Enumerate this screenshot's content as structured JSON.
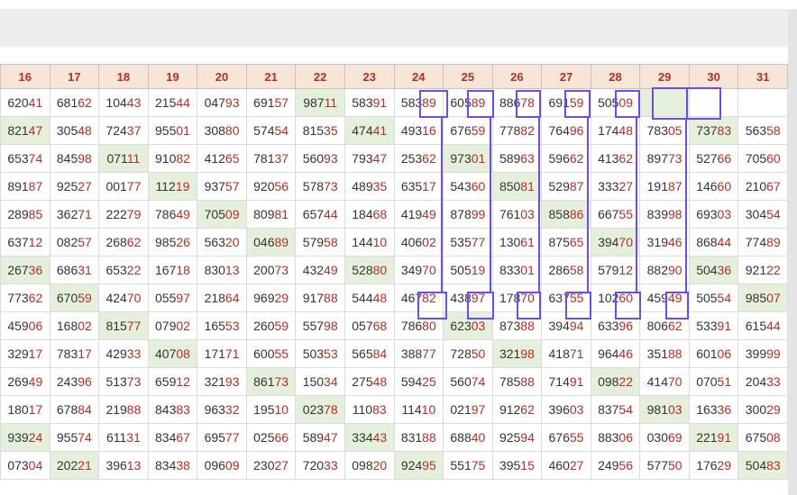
{
  "columns": [
    "16",
    "17",
    "18",
    "19",
    "20",
    "21",
    "22",
    "23",
    "24",
    "25",
    "26",
    "27",
    "28",
    "29",
    "30",
    "31"
  ],
  "rows": [
    [
      [
        "620",
        "41",
        0
      ],
      [
        "681",
        "62",
        0
      ],
      [
        "104",
        "43",
        0
      ],
      [
        "215",
        "44",
        0
      ],
      [
        "047",
        "93",
        0
      ],
      [
        "691",
        "57",
        0
      ],
      [
        "987",
        "11",
        1
      ],
      [
        "583",
        "91",
        0
      ],
      [
        "583",
        "89",
        0
      ],
      [
        "605",
        "89",
        0
      ],
      [
        "886",
        "78",
        0
      ],
      [
        "691",
        "59",
        0
      ],
      [
        "505",
        "09",
        0
      ],
      [
        "",
        "",
        1
      ],
      [
        "",
        "",
        0
      ],
      [
        "",
        "",
        0
      ]
    ],
    [
      [
        "821",
        "47",
        1
      ],
      [
        "305",
        "48",
        0
      ],
      [
        "724",
        "37",
        0
      ],
      [
        "955",
        "01",
        0
      ],
      [
        "308",
        "80",
        0
      ],
      [
        "574",
        "54",
        0
      ],
      [
        "815",
        "35",
        0
      ],
      [
        "474",
        "41",
        1
      ],
      [
        "493",
        "16",
        0
      ],
      [
        "676",
        "59",
        0
      ],
      [
        "778",
        "82",
        0
      ],
      [
        "764",
        "96",
        0
      ],
      [
        "174",
        "48",
        0
      ],
      [
        "783",
        "05",
        0
      ],
      [
        "737",
        "83",
        1
      ],
      [
        "563",
        "58",
        0
      ]
    ],
    [
      [
        "653",
        "74",
        0
      ],
      [
        "845",
        "98",
        0
      ],
      [
        "071",
        "11",
        1
      ],
      [
        "910",
        "82",
        0
      ],
      [
        "412",
        "65",
        0
      ],
      [
        "781",
        "37",
        0
      ],
      [
        "560",
        "93",
        0
      ],
      [
        "793",
        "47",
        0
      ],
      [
        "253",
        "62",
        0
      ],
      [
        "973",
        "01",
        1
      ],
      [
        "589",
        "63",
        0
      ],
      [
        "596",
        "62",
        0
      ],
      [
        "413",
        "62",
        0
      ],
      [
        "897",
        "73",
        0
      ],
      [
        "527",
        "66",
        0
      ],
      [
        "705",
        "60",
        0
      ]
    ],
    [
      [
        "891",
        "87",
        0
      ],
      [
        "925",
        "27",
        0
      ],
      [
        "001",
        "77",
        0
      ],
      [
        "112",
        "19",
        1
      ],
      [
        "937",
        "57",
        0
      ],
      [
        "920",
        "56",
        0
      ],
      [
        "578",
        "73",
        0
      ],
      [
        "489",
        "35",
        0
      ],
      [
        "635",
        "17",
        0
      ],
      [
        "543",
        "60",
        0
      ],
      [
        "850",
        "81",
        1
      ],
      [
        "529",
        "87",
        0
      ],
      [
        "333",
        "27",
        0
      ],
      [
        "191",
        "87",
        0
      ],
      [
        "146",
        "60",
        0
      ],
      [
        "210",
        "67",
        0
      ]
    ],
    [
      [
        "289",
        "85",
        0
      ],
      [
        "362",
        "71",
        0
      ],
      [
        "222",
        "79",
        0
      ],
      [
        "786",
        "49",
        0
      ],
      [
        "705",
        "09",
        1
      ],
      [
        "809",
        "81",
        0
      ],
      [
        "657",
        "44",
        0
      ],
      [
        "184",
        "68",
        0
      ],
      [
        "419",
        "49",
        0
      ],
      [
        "878",
        "99",
        0
      ],
      [
        "761",
        "03",
        0
      ],
      [
        "858",
        "86",
        1
      ],
      [
        "667",
        "55",
        0
      ],
      [
        "839",
        "98",
        0
      ],
      [
        "693",
        "03",
        0
      ],
      [
        "304",
        "54",
        0
      ]
    ],
    [
      [
        "637",
        "12",
        0
      ],
      [
        "082",
        "57",
        0
      ],
      [
        "268",
        "62",
        0
      ],
      [
        "985",
        "26",
        0
      ],
      [
        "563",
        "20",
        0
      ],
      [
        "046",
        "89",
        1
      ],
      [
        "579",
        "58",
        0
      ],
      [
        "144",
        "10",
        0
      ],
      [
        "406",
        "02",
        0
      ],
      [
        "535",
        "77",
        0
      ],
      [
        "130",
        "61",
        0
      ],
      [
        "875",
        "65",
        0
      ],
      [
        "394",
        "70",
        1
      ],
      [
        "319",
        "46",
        0
      ],
      [
        "868",
        "44",
        0
      ],
      [
        "774",
        "89",
        0
      ]
    ],
    [
      [
        "267",
        "36",
        1
      ],
      [
        "686",
        "31",
        0
      ],
      [
        "653",
        "22",
        0
      ],
      [
        "167",
        "18",
        0
      ],
      [
        "830",
        "13",
        0
      ],
      [
        "200",
        "73",
        0
      ],
      [
        "432",
        "49",
        0
      ],
      [
        "528",
        "80",
        1
      ],
      [
        "349",
        "70",
        0
      ],
      [
        "505",
        "19",
        0
      ],
      [
        "833",
        "01",
        0
      ],
      [
        "286",
        "58",
        0
      ],
      [
        "579",
        "12",
        0
      ],
      [
        "882",
        "90",
        0
      ],
      [
        "504",
        "36",
        1
      ],
      [
        "921",
        "22",
        0
      ]
    ],
    [
      [
        "773",
        "62",
        0
      ],
      [
        "670",
        "59",
        1
      ],
      [
        "424",
        "70",
        0
      ],
      [
        "055",
        "97",
        0
      ],
      [
        "218",
        "64",
        0
      ],
      [
        "969",
        "29",
        0
      ],
      [
        "917",
        "88",
        0
      ],
      [
        "544",
        "48",
        0
      ],
      [
        "467",
        "82",
        0
      ],
      [
        "438",
        "97",
        0
      ],
      [
        "178",
        "70",
        0
      ],
      [
        "637",
        "55",
        0
      ],
      [
        "102",
        "60",
        0
      ],
      [
        "459",
        "49",
        0
      ],
      [
        "505",
        "54",
        0
      ],
      [
        "985",
        "07",
        1
      ]
    ],
    [
      [
        "459",
        "06",
        0
      ],
      [
        "168",
        "02",
        0
      ],
      [
        "815",
        "77",
        1
      ],
      [
        "079",
        "02",
        0
      ],
      [
        "165",
        "53",
        0
      ],
      [
        "260",
        "59",
        0
      ],
      [
        "557",
        "98",
        0
      ],
      [
        "057",
        "68",
        0
      ],
      [
        "786",
        "80",
        0
      ],
      [
        "623",
        "03",
        1
      ],
      [
        "873",
        "88",
        0
      ],
      [
        "394",
        "94",
        0
      ],
      [
        "633",
        "96",
        0
      ],
      [
        "806",
        "62",
        0
      ],
      [
        "533",
        "91",
        0
      ],
      [
        "615",
        "44",
        0
      ]
    ],
    [
      [
        "329",
        "17",
        0
      ],
      [
        "783",
        "17",
        0
      ],
      [
        "429",
        "33",
        0
      ],
      [
        "407",
        "08",
        1
      ],
      [
        "171",
        "71",
        0
      ],
      [
        "600",
        "55",
        0
      ],
      [
        "503",
        "53",
        0
      ],
      [
        "565",
        "84",
        0
      ],
      [
        "388",
        "77",
        0
      ],
      [
        "728",
        "50",
        0
      ],
      [
        "321",
        "98",
        1
      ],
      [
        "418",
        "71",
        0
      ],
      [
        "964",
        "46",
        0
      ],
      [
        "351",
        "88",
        0
      ],
      [
        "601",
        "06",
        0
      ],
      [
        "399",
        "99",
        0
      ]
    ],
    [
      [
        "269",
        "49",
        0
      ],
      [
        "243",
        "96",
        0
      ],
      [
        "513",
        "73",
        0
      ],
      [
        "659",
        "12",
        0
      ],
      [
        "321",
        "93",
        0
      ],
      [
        "861",
        "73",
        1
      ],
      [
        "150",
        "34",
        0
      ],
      [
        "275",
        "48",
        0
      ],
      [
        "594",
        "25",
        0
      ],
      [
        "560",
        "74",
        0
      ],
      [
        "785",
        "88",
        0
      ],
      [
        "714",
        "91",
        0
      ],
      [
        "098",
        "22",
        1
      ],
      [
        "414",
        "70",
        0
      ],
      [
        "070",
        "51",
        0
      ],
      [
        "204",
        "33",
        0
      ]
    ],
    [
      [
        "180",
        "17",
        0
      ],
      [
        "678",
        "84",
        0
      ],
      [
        "219",
        "88",
        0
      ],
      [
        "843",
        "83",
        0
      ],
      [
        "963",
        "32",
        0
      ],
      [
        "195",
        "10",
        0
      ],
      [
        "023",
        "78",
        1
      ],
      [
        "110",
        "83",
        0
      ],
      [
        "114",
        "10",
        0
      ],
      [
        "021",
        "97",
        0
      ],
      [
        "912",
        "62",
        0
      ],
      [
        "396",
        "03",
        0
      ],
      [
        "837",
        "54",
        0
      ],
      [
        "981",
        "03",
        1
      ],
      [
        "163",
        "36",
        0
      ],
      [
        "300",
        "29",
        0
      ]
    ],
    [
      [
        "939",
        "24",
        1
      ],
      [
        "955",
        "74",
        0
      ],
      [
        "611",
        "31",
        0
      ],
      [
        "834",
        "67",
        0
      ],
      [
        "695",
        "77",
        0
      ],
      [
        "025",
        "66",
        0
      ],
      [
        "589",
        "47",
        0
      ],
      [
        "334",
        "43",
        1
      ],
      [
        "831",
        "88",
        0
      ],
      [
        "688",
        "40",
        0
      ],
      [
        "925",
        "94",
        0
      ],
      [
        "676",
        "55",
        0
      ],
      [
        "883",
        "06",
        0
      ],
      [
        "030",
        "69",
        0
      ],
      [
        "221",
        "91",
        1
      ],
      [
        "675",
        "08",
        0
      ]
    ],
    [
      [
        "073",
        "04",
        0
      ],
      [
        "202",
        "21",
        1
      ],
      [
        "396",
        "13",
        0
      ],
      [
        "834",
        "38",
        0
      ],
      [
        "096",
        "09",
        0
      ],
      [
        "230",
        "27",
        0
      ],
      [
        "720",
        "33",
        0
      ],
      [
        "098",
        "20",
        0
      ],
      [
        "924",
        "95",
        1
      ],
      [
        "551",
        "75",
        0
      ],
      [
        "395",
        "15",
        0
      ],
      [
        "460",
        "27",
        0
      ],
      [
        "249",
        "56",
        0
      ],
      [
        "577",
        "50",
        0
      ],
      [
        "176",
        "29",
        0
      ],
      [
        "504",
        "83",
        1
      ]
    ]
  ],
  "colors": {
    "header_bg": "#f5e6d7",
    "header_text": "#b52d24",
    "tail_text": "#b52d24",
    "highlight_bg": "#e5f0dc",
    "marker": "#6a4cf0"
  }
}
